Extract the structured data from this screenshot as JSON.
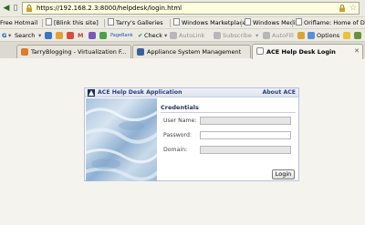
{
  "browser": {
    "url": "https://192.168.2.3:8000/helpdesk/login.html",
    "bookmarks": [
      "Free Hotmail",
      "[Blink this site]",
      "Tarry's Galleries",
      "Windows Marketplace",
      "Windows Media",
      "Oriflame: Home of Dat..."
    ],
    "toolbar": {
      "search_label": "Search",
      "pagerank_label": "PageRank",
      "check_label": "Check",
      "autolink_label": "AutoLink",
      "subscribe_label": "Subscribe",
      "autofill_label": "AutoFill",
      "options_label": "Options"
    },
    "tabs": [
      {
        "label": "TarryBlogging - Virtualization F...",
        "active": false
      },
      {
        "label": "Appliance System Management",
        "active": false
      },
      {
        "label": "ACE Help Desk Login",
        "active": true
      }
    ]
  },
  "login": {
    "app_title": "ACE Help Desk Application",
    "about_link": "About ACE",
    "section_title": "Credentials",
    "fields": [
      {
        "label": "User Name:",
        "value": ""
      },
      {
        "label": "Password:",
        "value": ""
      },
      {
        "label": "Domain:",
        "value": ""
      }
    ],
    "submit_label": "Login"
  }
}
